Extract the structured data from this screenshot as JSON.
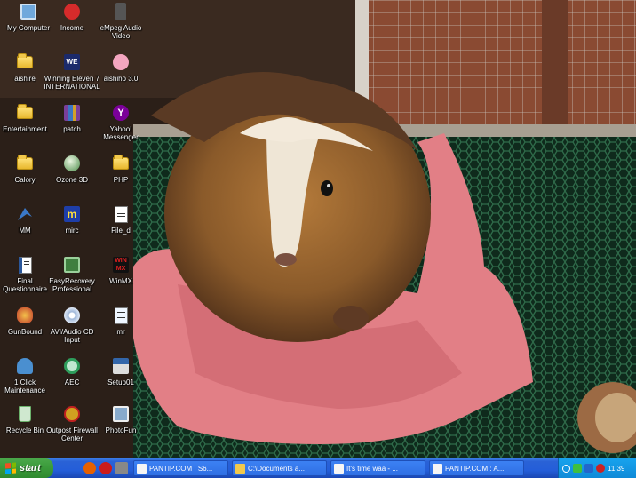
{
  "desktop": {
    "icons": [
      {
        "label": "My Computer",
        "icon": "computer-icon",
        "color": "#6fa8dc"
      },
      {
        "label": "Income",
        "icon": "shield-app-icon",
        "color": "#d62b2b"
      },
      {
        "label": "eMpeg Audio Video",
        "icon": "media-player-icon",
        "color": "#555555"
      },
      {
        "label": "aishire",
        "icon": "folder-icon",
        "color": "#f2c94c"
      },
      {
        "label": "Winning Eleven 7 INTERNATIONAL",
        "icon": "game-we7-icon",
        "color": "#1b2a6b"
      },
      {
        "label": "aishiho 3.0",
        "icon": "anime-app-icon",
        "color": "#f4a6c0"
      },
      {
        "label": "Entertainment",
        "icon": "folder-icon",
        "color": "#f2c94c"
      },
      {
        "label": "patch",
        "icon": "archive-icon",
        "color": "#7a3f9b"
      },
      {
        "label": "Yahoo! Messenger",
        "icon": "yahoo-messenger-icon",
        "color": "#7b0099"
      },
      {
        "label": "Calory",
        "icon": "folder-icon",
        "color": "#f2c94c"
      },
      {
        "label": "Ozone 3D",
        "icon": "globe-icon",
        "color": "#4c8c4a"
      },
      {
        "label": "PHP",
        "icon": "folder-icon",
        "color": "#f2c94c"
      },
      {
        "label": "MM",
        "icon": "media-icon",
        "color": "#3a78c8"
      },
      {
        "label": "mirc",
        "icon": "mirc-icon",
        "color": "#e03a1e"
      },
      {
        "label": "File_d",
        "icon": "document-icon",
        "color": "#ffffff"
      },
      {
        "label": "Final Questionnaire",
        "icon": "word-document-icon",
        "color": "#2b579a"
      },
      {
        "label": "EasyRecovery Professional",
        "icon": "recovery-icon",
        "color": "#3f7f3f"
      },
      {
        "label": "WinMX",
        "icon": "winmx-icon",
        "color": "#111111"
      },
      {
        "label": "GunBound",
        "icon": "game-gunbound-icon",
        "color": "#c0392b"
      },
      {
        "label": "AVI/Audio CD Input",
        "icon": "cd-icon",
        "color": "#9fb7d8"
      },
      {
        "label": "mr",
        "icon": "shortcut-icon",
        "color": "#5aa0e6"
      },
      {
        "label": "1 Click Maintenance",
        "icon": "maintenance-icon",
        "color": "#4a8fd0"
      },
      {
        "label": "AEC",
        "icon": "sync-icon",
        "color": "#2e9e5c"
      },
      {
        "label": "Setup01",
        "icon": "setup-icon",
        "color": "#3366aa"
      },
      {
        "label": "Recycle Bin",
        "icon": "recycle-bin-icon",
        "color": "#6cb36c"
      },
      {
        "label": "Outpost Firewall Center",
        "icon": "firewall-icon",
        "color": "#d0a020"
      },
      {
        "label": "PhotoFun",
        "icon": "photo-app-icon",
        "color": "#88aacc"
      }
    ]
  },
  "taskbar": {
    "start_label": "start",
    "quick_launch": [
      {
        "icon": "firefox-icon",
        "color": "#e66000"
      },
      {
        "icon": "opera-icon",
        "color": "#cc1b1b"
      },
      {
        "icon": "media-icon",
        "color": "#888888"
      },
      {
        "icon": "ie-icon",
        "color": "#2f78d0"
      }
    ],
    "tasks": [
      {
        "label": "PANTIP.COM : S6...",
        "icon": "browser-icon",
        "color": "#f5f5f5"
      },
      {
        "label": "C:\\Documents a...",
        "icon": "folder-icon",
        "color": "#f2c94c"
      },
      {
        "label": "It's time waa - ...",
        "icon": "browser-icon",
        "color": "#f5f5f5"
      },
      {
        "label": "PANTIP.COM : A...",
        "icon": "browser-icon",
        "color": "#f5f5f5"
      }
    ],
    "tray": {
      "icons": [
        {
          "icon": "arrow-left-icon",
          "color": "#ffffff"
        },
        {
          "icon": "network-icon",
          "color": "#3fbf3f"
        },
        {
          "icon": "antivirus-icon",
          "color": "#2266cc"
        },
        {
          "icon": "shield-icon",
          "color": "#cc2222"
        }
      ],
      "clock": "11:39"
    }
  }
}
